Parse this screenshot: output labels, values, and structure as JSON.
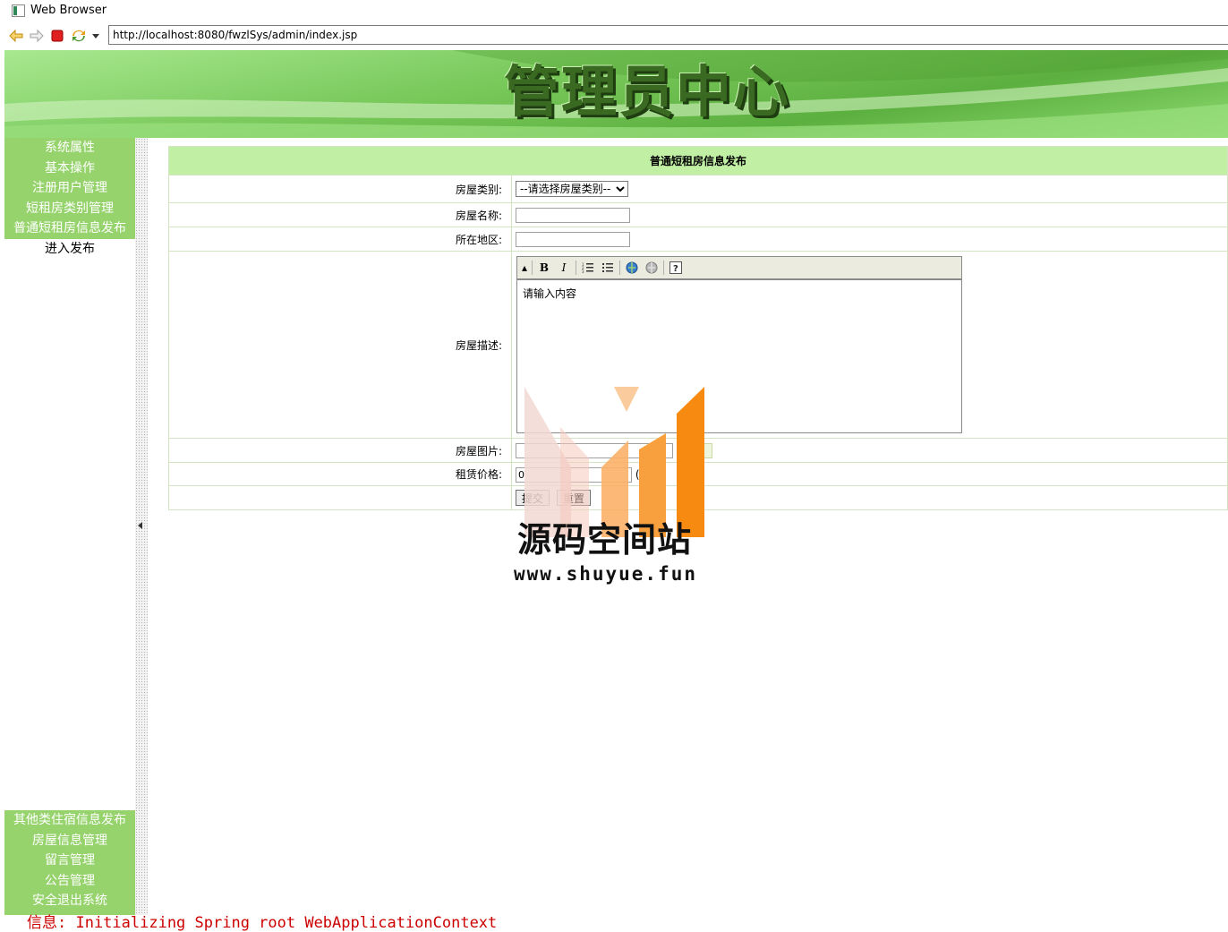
{
  "window": {
    "title": "Web Browser"
  },
  "browser": {
    "url": "http://localhost:8080/fwzlSys/admin/index.jsp"
  },
  "banner": {
    "title": "管理员中心"
  },
  "sidebar": {
    "top_items": [
      {
        "label": "系统属性"
      },
      {
        "label": "基本操作"
      },
      {
        "label": "注册用户管理"
      },
      {
        "label": "短租房类别管理"
      },
      {
        "label": "普通短租房信息发布"
      }
    ],
    "sub_item": "进入发布",
    "bottom_items": [
      {
        "label": "其他类住宿信息发布"
      },
      {
        "label": "房屋信息管理"
      },
      {
        "label": "留言管理"
      },
      {
        "label": "公告管理"
      },
      {
        "label": "安全退出系统"
      }
    ]
  },
  "form": {
    "title": "普通短租房信息发布",
    "type_label": "房屋类别:",
    "type_select": "--请选择房屋类别--",
    "name_label": "房屋名称:",
    "name_value": "",
    "region_label": "所在地区:",
    "region_value": "",
    "desc_label": "房屋描述:",
    "desc_placeholder": "请输入内容",
    "image_label": "房屋图片:",
    "price_label": "租赁价格:",
    "price_value": "0",
    "price_unit": "(元",
    "submit": "提交",
    "reset": "重置"
  },
  "watermark": {
    "title": "源码空间站",
    "url": "www.shuyue.fun"
  },
  "console": {
    "text": "信息: Initializing Spring root WebApplicationContext"
  }
}
